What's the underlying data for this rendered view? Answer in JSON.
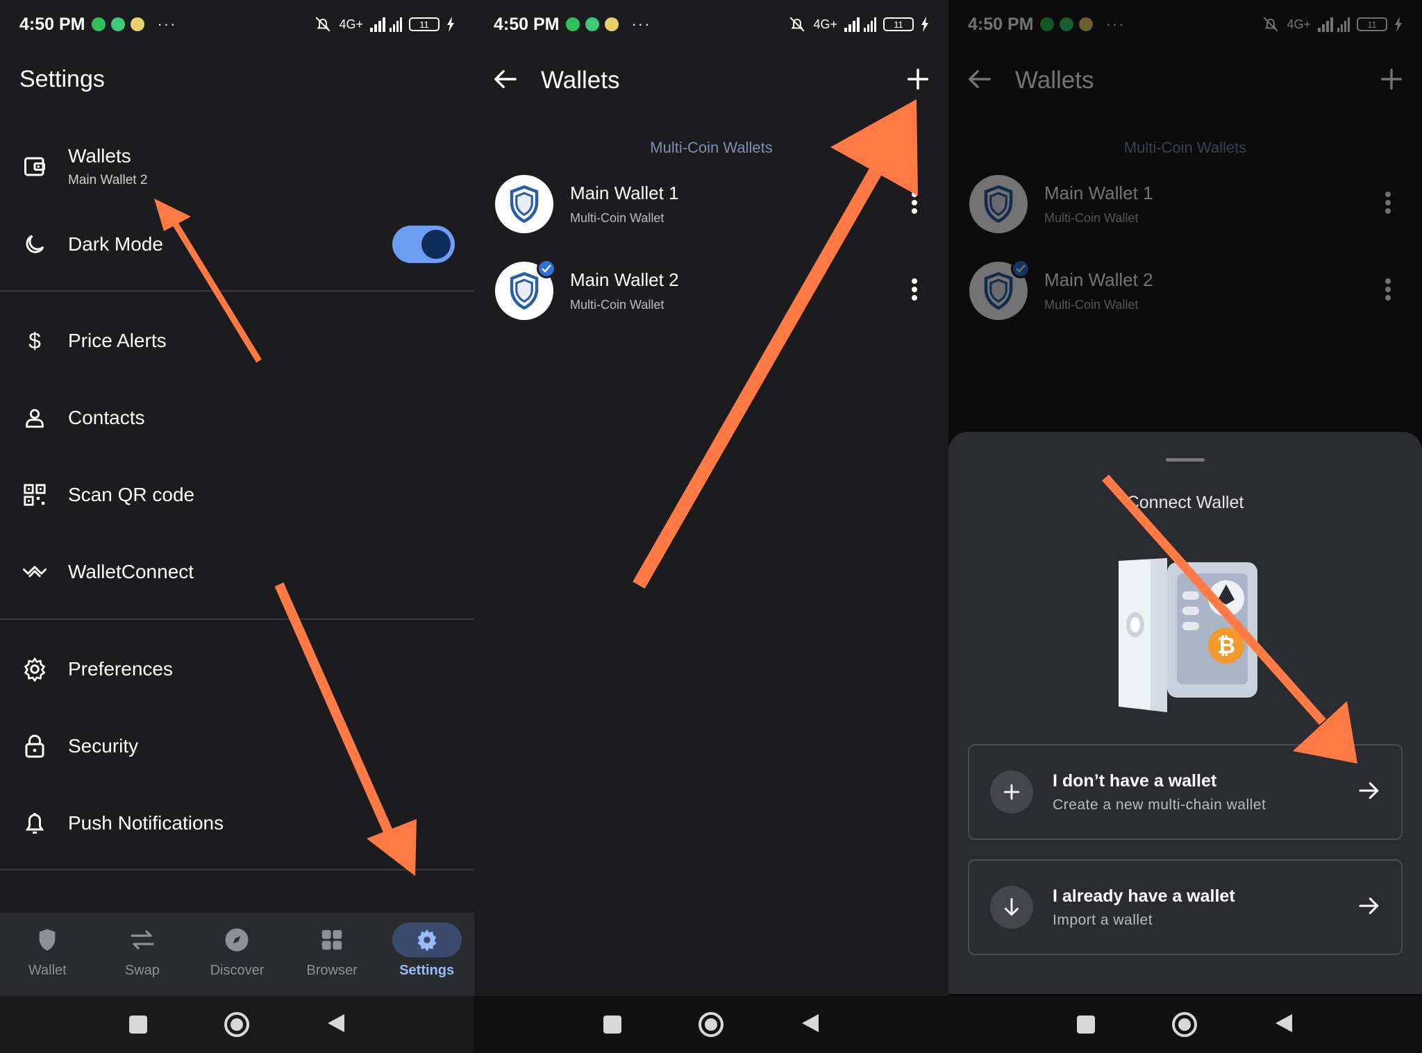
{
  "status": {
    "time": "4:50 PM",
    "more": "···",
    "network": "4G+",
    "battery": "11"
  },
  "settings": {
    "title": "Settings",
    "wallets_label": "Wallets",
    "wallets_sub": "Main Wallet 2",
    "dark_mode_label": "Dark Mode",
    "items": [
      "Price Alerts",
      "Contacts",
      "Scan QR code",
      "WalletConnect",
      "Preferences",
      "Security",
      "Push Notifications"
    ],
    "tabs": [
      "Wallet",
      "Swap",
      "Discover",
      "Browser",
      "Settings"
    ],
    "active_tab": "Settings"
  },
  "wallets": {
    "title": "Wallets",
    "section": "Multi-Coin Wallets",
    "list": [
      {
        "name": "Main Wallet 1",
        "type": "Multi-Coin Wallet"
      },
      {
        "name": "Main Wallet 2",
        "type": "Multi-Coin Wallet"
      }
    ]
  },
  "connect": {
    "title": "Connect Wallet",
    "options": [
      {
        "title": "I don’t have a wallet",
        "subtitle": "Create a new multi-chain wallet"
      },
      {
        "title": "I already have a wallet",
        "subtitle": "Import a wallet"
      }
    ]
  },
  "colors": {
    "accent": "#6d9ef4",
    "arrow": "#ff7a45",
    "background": "#1c1c1e"
  }
}
